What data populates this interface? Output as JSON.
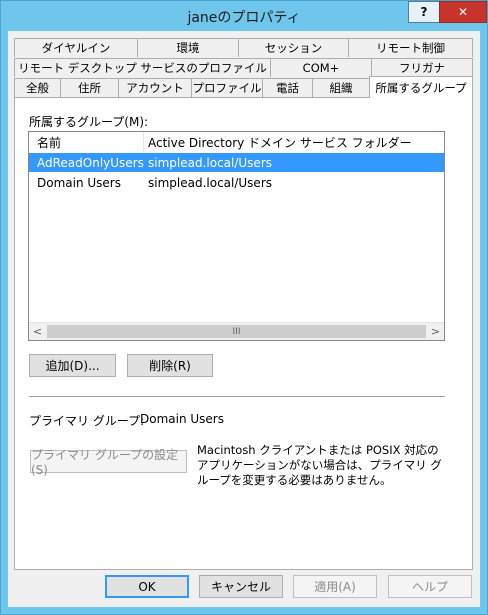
{
  "window": {
    "title": "janeのプロパティ",
    "help_button": "?",
    "close_button": "✕"
  },
  "tabs": {
    "row1": [
      "ダイヤルイン",
      "環境",
      "セッション",
      "リモート制御"
    ],
    "row2": [
      "リモート デスクトップ サービスのプロファイル",
      "COM+",
      "フリガナ"
    ],
    "row3": [
      "全般",
      "住所",
      "アカウント",
      "プロファイル",
      "電話",
      "組織",
      "所属するグループ"
    ],
    "active": "所属するグループ"
  },
  "panel": {
    "groups_label": "所属するグループ(M):",
    "columns": [
      "名前",
      "Active Directory ドメイン サービス フォルダー"
    ],
    "rows": [
      {
        "name": "AdReadOnlyUsers",
        "folder": "simplead.local/Users",
        "selected": true
      },
      {
        "name": "Domain Users",
        "folder": "simplead.local/Users",
        "selected": false
      }
    ],
    "scroll_left": "<",
    "scroll_right": ">",
    "scroll_thumb": "III",
    "add_button": "追加(D)...",
    "remove_button": "削除(R)",
    "primary_group_label": "プライマリ グループ:",
    "primary_group_value": "Domain Users",
    "set_primary_button": "プライマリ グループの設定(S)",
    "note": "Macintosh クライアントまたは POSIX 対応のアプリケーションがない場合は、プライマリ グループを変更する必要はありません。"
  },
  "footer": {
    "ok": "OK",
    "cancel": "キャンセル",
    "apply": "適用(A)",
    "help": "ヘルプ"
  },
  "colors": {
    "titlebar": "#6fc6ec",
    "close": "#c7342b",
    "selection": "#3399ff"
  }
}
